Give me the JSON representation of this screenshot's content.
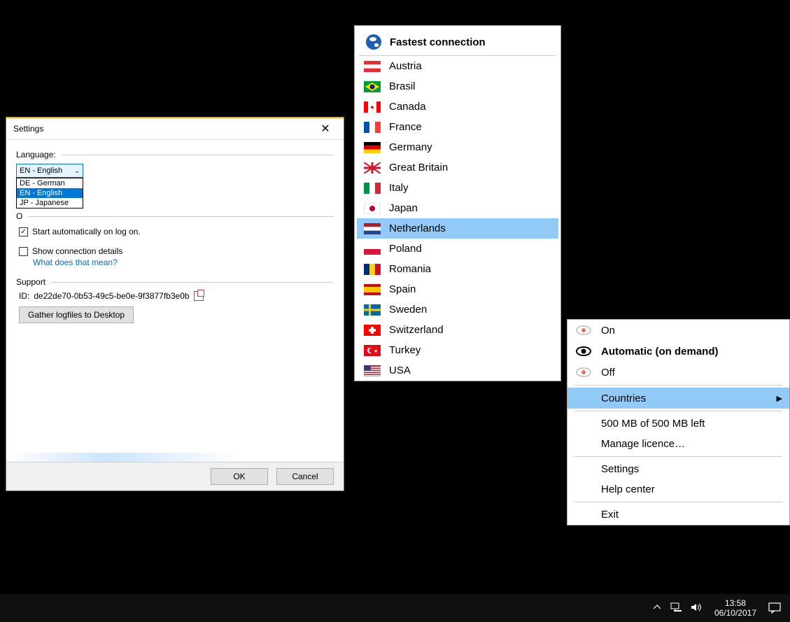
{
  "settings": {
    "title": "Settings",
    "language_label": "Language:",
    "selected_lang": "EN - English",
    "lang_options": [
      "DE - German",
      "EN - English",
      "JP - Japanese"
    ],
    "other_label": "O",
    "auto_start": "Start automatically on log on.",
    "show_details": "Show connection details",
    "help_link": "What does that mean?",
    "support_label": "Support",
    "id_label": "ID:",
    "id_value": "de22de70-0b53-49c5-be0e-9f3877fb3e0b",
    "gather_btn": "Gather logfiles to Desktop",
    "ok": "OK",
    "cancel": "Cancel"
  },
  "countries": {
    "header": "Fastest connection",
    "list": [
      "Austria",
      "Brasil",
      "Canada",
      "France",
      "Germany",
      "Great Britain",
      "Italy",
      "Japan",
      "Netherlands",
      "Poland",
      "Romania",
      "Spain",
      "Sweden",
      "Switzerland",
      "Turkey",
      "USA"
    ],
    "highlighted": "Netherlands",
    "flags": {
      "Austria": {
        "type": "tri-h",
        "c": [
          "#ed2939",
          "#fff",
          "#ed2939"
        ]
      },
      "Brasil": {
        "type": "br"
      },
      "Canada": {
        "type": "ca"
      },
      "France": {
        "type": "tri-v",
        "c": [
          "#0055a4",
          "#fff",
          "#ef4135"
        ]
      },
      "Germany": {
        "type": "tri-h",
        "c": [
          "#000",
          "#dd0000",
          "#ffce00"
        ]
      },
      "Great Britain": {
        "type": "gb"
      },
      "Italy": {
        "type": "tri-v",
        "c": [
          "#009246",
          "#fff",
          "#ce2b37"
        ]
      },
      "Japan": {
        "type": "jp"
      },
      "Netherlands": {
        "type": "tri-h",
        "c": [
          "#ae1c28",
          "#fff",
          "#21468b"
        ]
      },
      "Poland": {
        "type": "bi-h",
        "c": [
          "#fff",
          "#dc143c"
        ]
      },
      "Romania": {
        "type": "tri-v",
        "c": [
          "#002b7f",
          "#fcd116",
          "#ce1126"
        ]
      },
      "Spain": {
        "type": "es"
      },
      "Sweden": {
        "type": "se"
      },
      "Switzerland": {
        "type": "ch"
      },
      "Turkey": {
        "type": "tr"
      },
      "USA": {
        "type": "us"
      }
    }
  },
  "tray": {
    "on": "On",
    "auto": "Automatic (on demand)",
    "off": "Off",
    "countries": "Countries",
    "quota": "500 MB of 500 MB left",
    "licence": "Manage licence…",
    "settings": "Settings",
    "help": "Help center",
    "exit": "Exit"
  },
  "taskbar": {
    "time": "13:58",
    "date": "06/10/2017"
  }
}
